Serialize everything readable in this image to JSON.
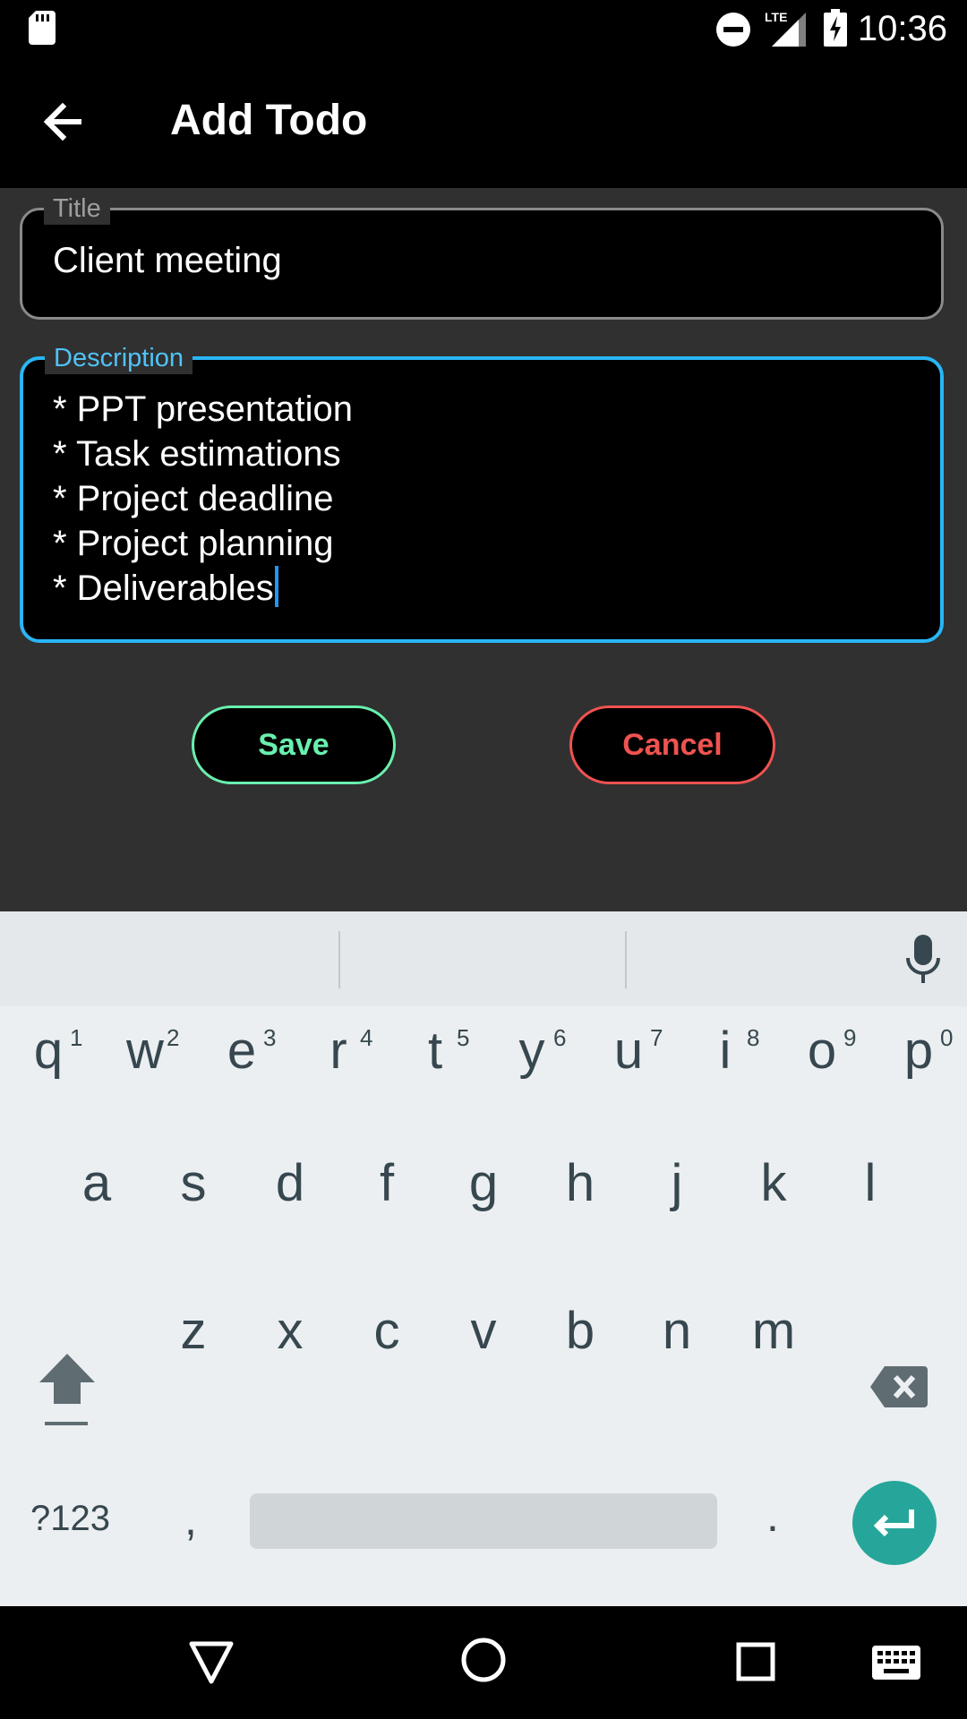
{
  "status_bar": {
    "time": "10:36",
    "icons": [
      "sd-card-icon",
      "do-not-disturb-icon",
      "lte-signal-icon",
      "battery-charging-icon"
    ],
    "network_label": "LTE"
  },
  "app_bar": {
    "title": "Add Todo"
  },
  "form": {
    "title_field": {
      "label": "Title",
      "value": "Client meeting"
    },
    "description_field": {
      "label": "Description",
      "lines": [
        "* PPT presentation",
        "* Task estimations",
        "* Project deadline",
        "* Project planning",
        "* Deliverables"
      ]
    },
    "save_label": "Save",
    "cancel_label": "Cancel"
  },
  "keyboard": {
    "row1": [
      {
        "key": "q",
        "hint": "1"
      },
      {
        "key": "w",
        "hint": "2"
      },
      {
        "key": "e",
        "hint": "3"
      },
      {
        "key": "r",
        "hint": "4"
      },
      {
        "key": "t",
        "hint": "5"
      },
      {
        "key": "y",
        "hint": "6"
      },
      {
        "key": "u",
        "hint": "7"
      },
      {
        "key": "i",
        "hint": "8"
      },
      {
        "key": "o",
        "hint": "9"
      },
      {
        "key": "p",
        "hint": "0"
      }
    ],
    "row2": [
      "a",
      "s",
      "d",
      "f",
      "g",
      "h",
      "j",
      "k",
      "l"
    ],
    "row3": [
      "z",
      "x",
      "c",
      "v",
      "b",
      "n",
      "m"
    ],
    "symbols_label": "?123",
    "comma_label": ",",
    "period_label": "."
  },
  "colors": {
    "accent_blue": "#29b6f6",
    "save_green": "#69f0ae",
    "cancel_red": "#ef5350",
    "enter_teal": "#26a69a"
  }
}
